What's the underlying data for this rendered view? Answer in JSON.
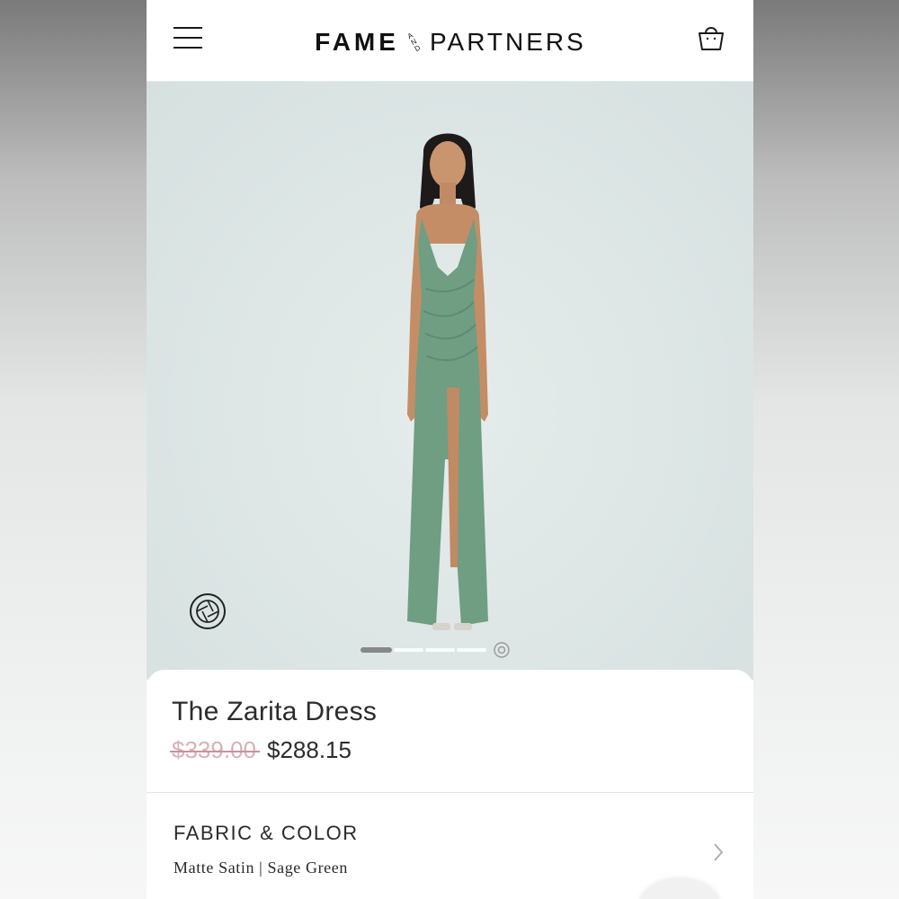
{
  "header": {
    "menu_icon": "hamburger-menu-icon",
    "logo": {
      "word1": "FAME",
      "and_top": "A",
      "and_mid": "N",
      "and_bot": "D",
      "word2": "PARTNERS"
    },
    "bag_icon": "shopping-bag-icon"
  },
  "gallery": {
    "view_360_icon": "camera-aperture-icon",
    "slides_total": 5,
    "active_slide": 1
  },
  "product": {
    "title": "The Zarita Dress",
    "original_price": "$339.00",
    "sale_price": "$288.15"
  },
  "fabric_color": {
    "heading": "FABRIC & COLOR",
    "value": "Matte Satin | Sage Green",
    "chevron_icon": "chevron-right-icon"
  },
  "colors": {
    "dress": "#6f9e83",
    "background": "#dde6e5",
    "strike": "#c9939c"
  }
}
